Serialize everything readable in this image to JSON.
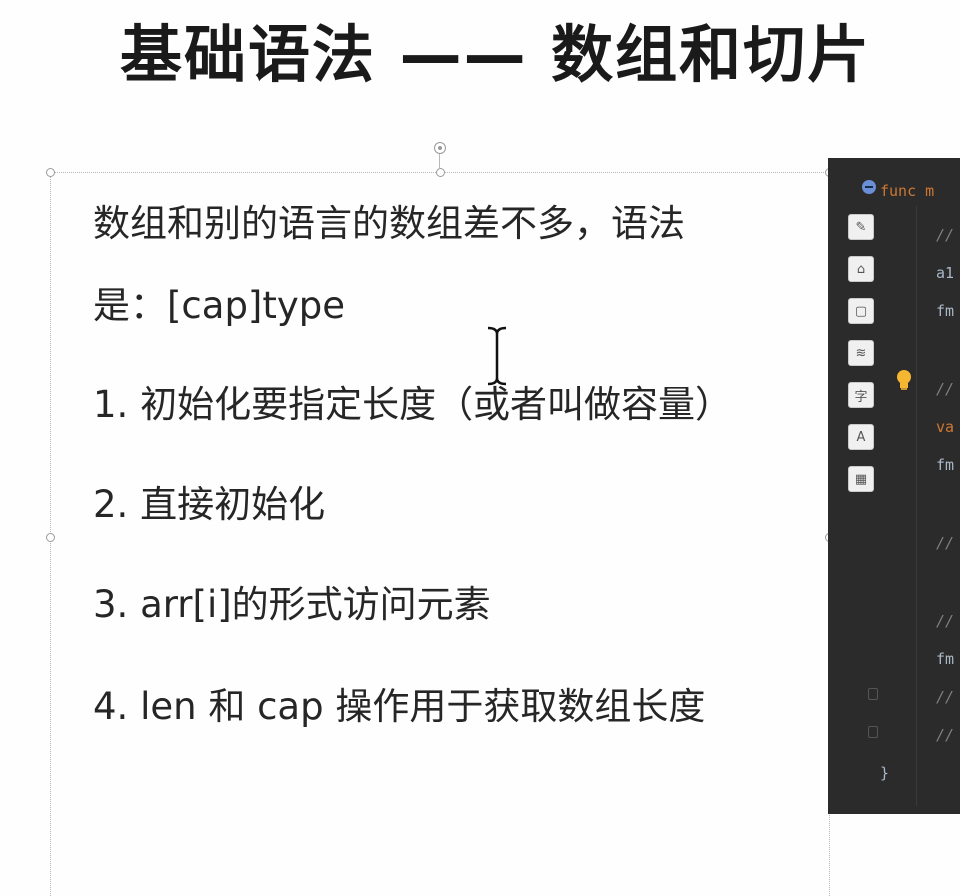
{
  "slide": {
    "title": "基础语法 —— 数组和切片",
    "intro_line1": "数组和别的语言的数组差不多，语法",
    "intro_line2": "是：[cap]type",
    "items": [
      "1. 初始化要指定长度（或者叫做容量）",
      "2. 直接初始化",
      "3. arr[i]的形式访问元素",
      "4. len 和 cap 操作用于获取数组长度"
    ]
  },
  "editor": {
    "code_lines": [
      {
        "text": "func m",
        "kind": "keyword"
      },
      {
        "text": "//",
        "kind": "comment"
      },
      {
        "text": "a1",
        "kind": "plain"
      },
      {
        "text": "fm",
        "kind": "plain"
      },
      {
        "text": "//",
        "kind": "comment"
      },
      {
        "text": "va",
        "kind": "keyword"
      },
      {
        "text": "fm",
        "kind": "plain"
      },
      {
        "text": "//",
        "kind": "comment"
      },
      {
        "text": "//",
        "kind": "comment"
      },
      {
        "text": "fm",
        "kind": "plain"
      },
      {
        "text": "//",
        "kind": "comment"
      },
      {
        "text": "//",
        "kind": "comment"
      },
      {
        "text": "}",
        "kind": "plain"
      }
    ],
    "toolbar_icons": [
      "pencil-icon",
      "shape-icon",
      "rectangle-icon",
      "layers-icon",
      "text-icon",
      "image-text-icon",
      "grid-icon"
    ],
    "toolbar_glyphs": [
      "✎",
      "⌂",
      "▢",
      "≋",
      "字",
      "A",
      "▦"
    ]
  },
  "colors": {
    "editor_bg": "#2b2b2b",
    "keyword": "#cc7832",
    "comment": "#808080",
    "text": "#262626"
  }
}
